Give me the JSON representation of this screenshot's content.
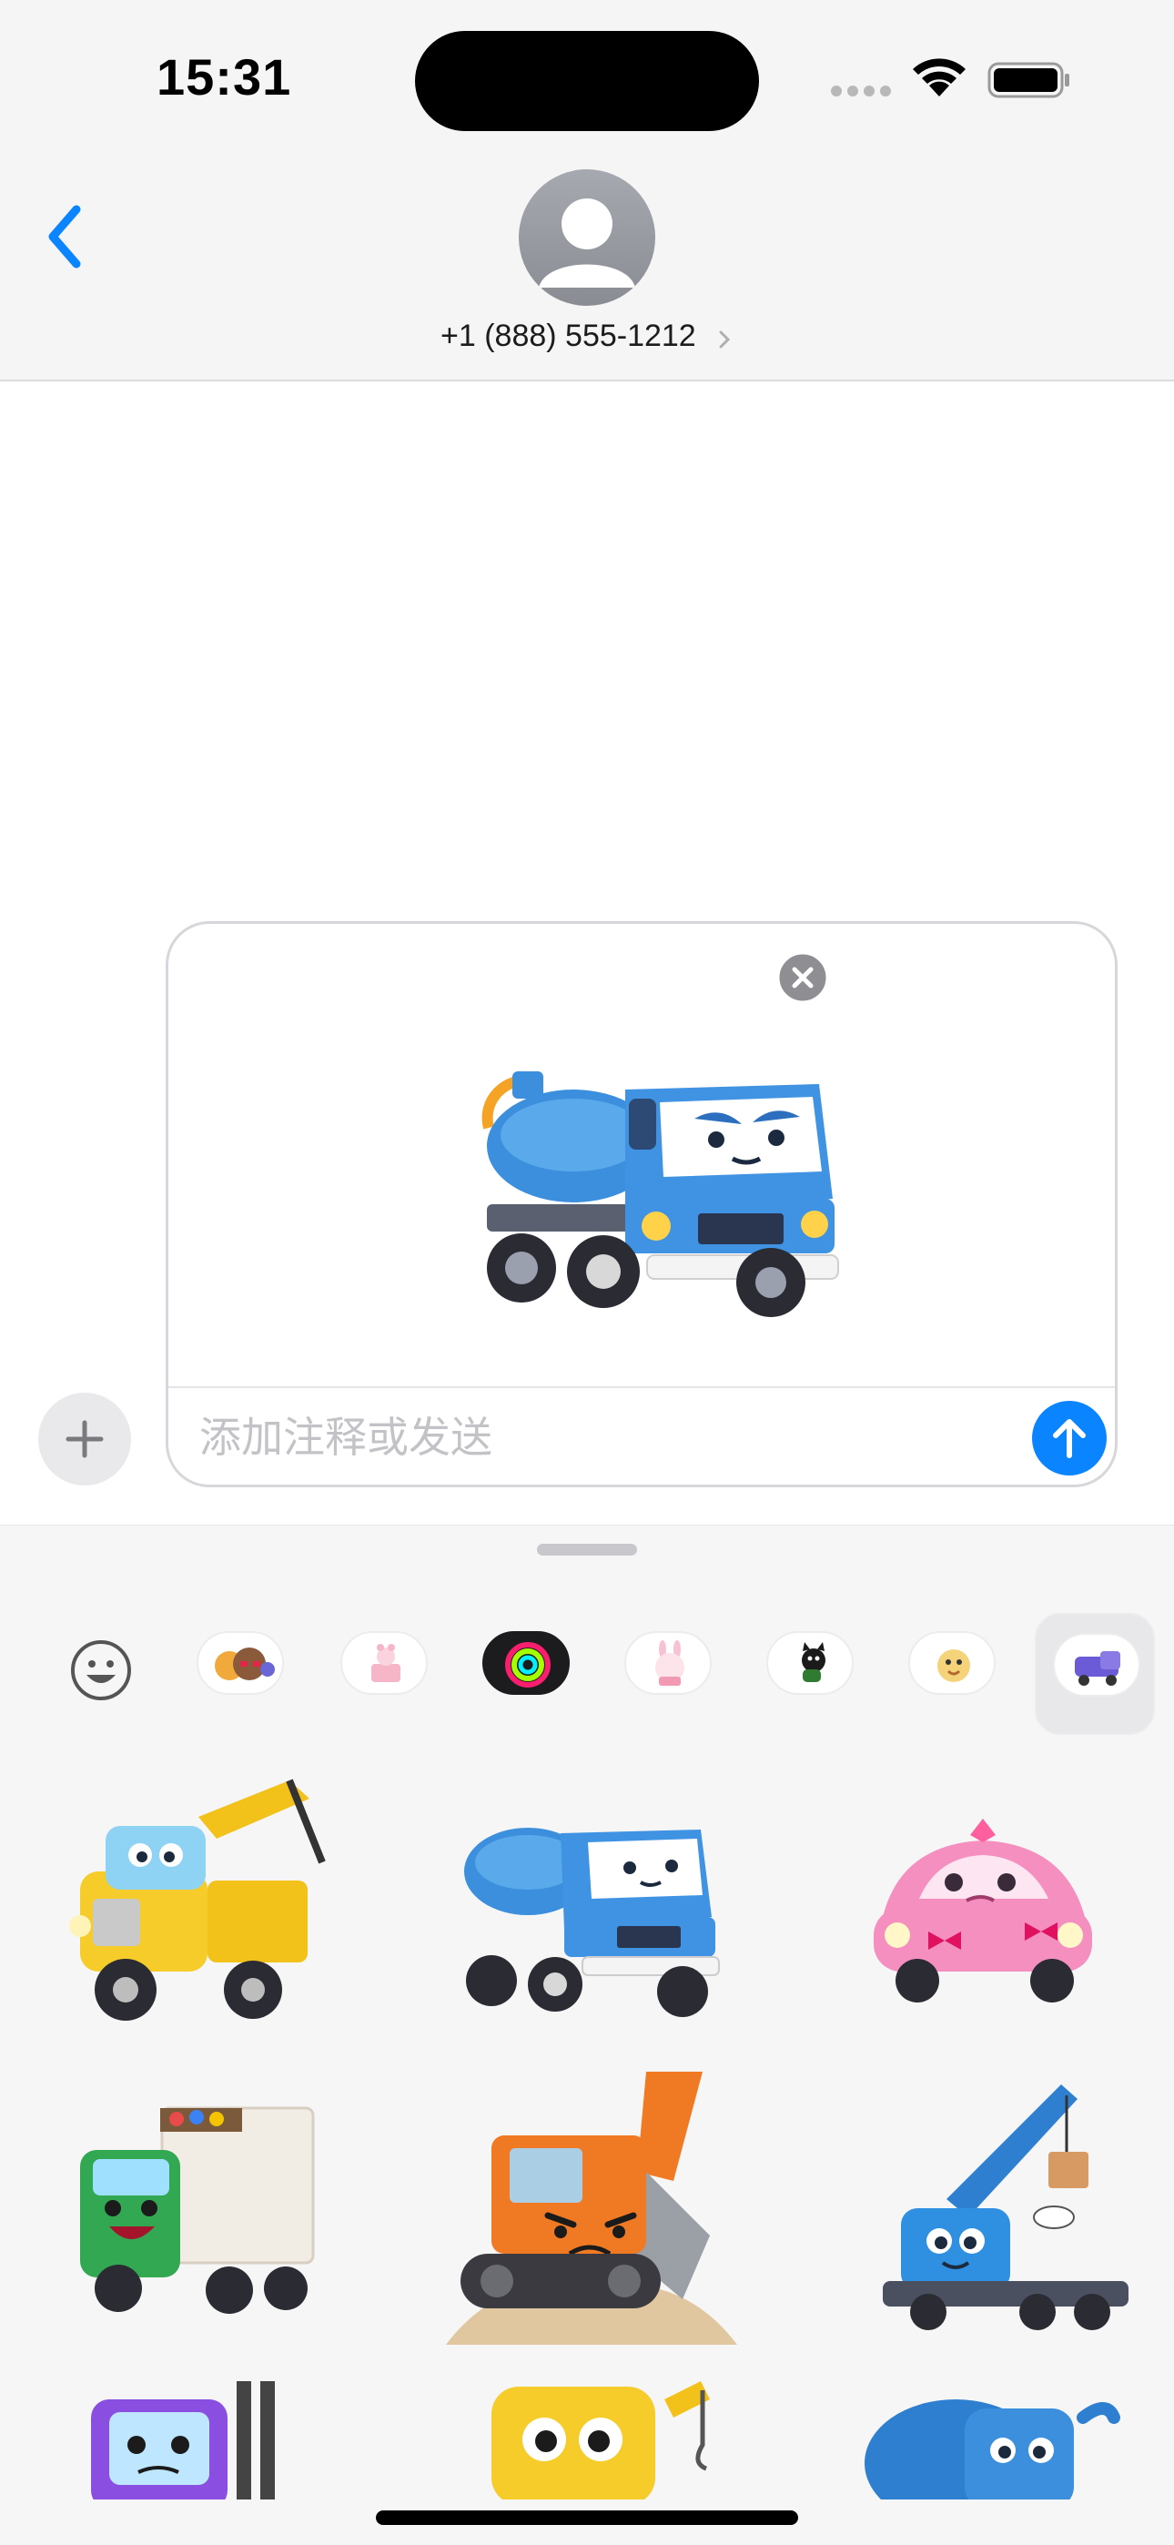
{
  "status_bar": {
    "time": "15:31"
  },
  "conversation": {
    "contact_name": "+1 (888) 555-1212"
  },
  "compose": {
    "placeholder": "添加注释或发送",
    "attachment": {
      "sticker": "blue-tanker-truck-sticker"
    }
  },
  "icons": {
    "back": "chevron-left-icon",
    "plus": "plus-icon",
    "send": "arrow-up-icon",
    "remove": "close-icon",
    "emoji": "smiley-icon"
  },
  "colors": {
    "accent": "#0a84ff",
    "header_bg": "#f5f5f5",
    "drawer_bg": "#f6f6f6"
  },
  "sticker_packs": [
    {
      "name": "emoji-pack"
    },
    {
      "name": "memoji-pack"
    },
    {
      "name": "pink-cake-pack"
    },
    {
      "name": "activity-rings-pack"
    },
    {
      "name": "pink-bunny-pack"
    },
    {
      "name": "black-cat-pack"
    },
    {
      "name": "yellow-character-pack"
    },
    {
      "name": "vehicles-pack",
      "selected": true
    }
  ],
  "stickers": [
    "yellow-crane-truck",
    "blue-tanker-truck",
    "pink-car",
    "green-box-truck",
    "orange-excavator",
    "blue-mobile-crane",
    "purple-forklift",
    "yellow-crane",
    "blue-vacuum-truck"
  ]
}
